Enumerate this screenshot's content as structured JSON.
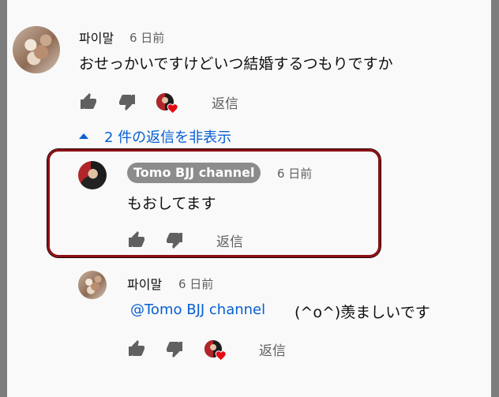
{
  "comment": {
    "author": "파이말",
    "time": "6 日前",
    "text": "おせっかいですけどいつ結婚するつもりですか",
    "reply_label": "返信"
  },
  "replies_toggle": {
    "label": "2 件の返信を非表示"
  },
  "reply1": {
    "author": "Tomo BJJ channel",
    "time": "6 日前",
    "text": "もおしてます",
    "reply_label": "返信"
  },
  "reply2": {
    "author": "파이말",
    "time": "6 日前",
    "mention": "@Tomo BJJ channel",
    "text": "(^o^)羡ましいです",
    "reply_label": "返信"
  },
  "colors": {
    "link": "#065fd4",
    "highlight_border": "#8b0f14",
    "heart": "#e50914"
  }
}
